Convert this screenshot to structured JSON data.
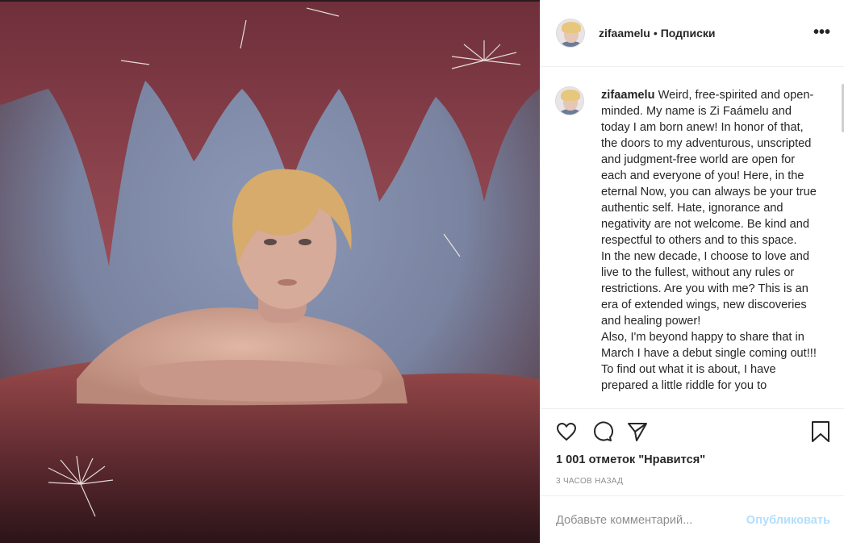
{
  "post": {
    "username": "zifaamelu",
    "separator": "•",
    "follow_label": "Подписки",
    "more_icon": "more-options-icon",
    "caption_username": "zifaamelu",
    "caption_text": " Weird, free-spirited and open-minded. My name is Zi Faámelu and today I am born anew! In honor of that, the doors to my adventurous, unscripted and judgment-free world are open for each and everyone of you! Here, in the eternal Now, you can always be your true authentic self. Hate, ignorance and negativity are not welcome. Be kind and respectful to others and to this space.\nIn the new decade, I choose to love and live to the fullest, without any rules or restrictions. Are you with me? This is an era of extended wings, new discoveries and healing power!\nAlso, I'm beyond happy to share that in March I have a debut single coming out!!! To find out what it is about, I have prepared a little riddle for you to",
    "likes": "1 001 отметок \"Нравится\"",
    "time": "3 ЧАСОВ НАЗАД"
  },
  "actions": {
    "like_icon": "heart-icon",
    "comment_icon": "comment-icon",
    "share_icon": "share-icon",
    "save_icon": "bookmark-icon"
  },
  "comment_box": {
    "placeholder": "Добавьте комментарий...",
    "publish_label": "Опубликовать"
  },
  "colors": {
    "publish_disabled": "#b2dffc",
    "muted": "#8e8e8e",
    "text": "#262626"
  }
}
